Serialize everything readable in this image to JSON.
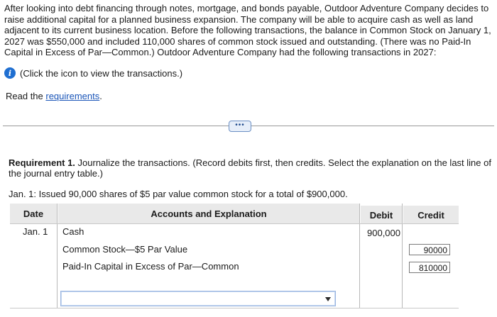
{
  "intro": {
    "paragraph": "After looking into debt financing through notes, mortgage, and bonds payable, Outdoor Adventure Company decides to raise additional capital for a planned business expansion. The company will be able to acquire cash as well as land adjacent to its current business location. Before the following transactions, the balance in Common Stock on January 1, 2027 was $550,000 and included 110,000 shares of common stock issued and outstanding. (There was no Paid-In Capital in Excess of Par—Common.) Outdoor Adventure Company had the following transactions in 2027:",
    "info_icon_glyph": "i",
    "info_link_text": "(Click the icon to view the transactions.)"
  },
  "read": {
    "prefix": "Read the ",
    "link_text": "requirements",
    "suffix": "."
  },
  "more_button": "•••",
  "requirement": {
    "title": "Requirement 1.",
    "instructions": " Journalize the transactions. (Record debits first, then credits. Select the explanation on the last line of the journal entry table.)",
    "transaction": "Jan. 1: Issued 90,000 shares of $5 par value common stock for a total of $900,000."
  },
  "journal": {
    "headers": {
      "date": "Date",
      "accounts": "Accounts and Explanation",
      "debit": "Debit",
      "credit": "Credit"
    },
    "rows": [
      {
        "date": "Jan. 1",
        "account": "Cash",
        "debit": "900,000",
        "credit": ""
      },
      {
        "date": "",
        "account": "Common Stock—$5 Par Value",
        "debit": "",
        "credit": "90000"
      },
      {
        "date": "",
        "account": "Paid-In Capital in Excess of Par—Common",
        "debit": "",
        "credit": "810000"
      }
    ],
    "explanation_selected": ""
  },
  "colors": {
    "link": "#1a55b8",
    "info_icon": "#1f6fd1",
    "header_bg": "#e9e9e9"
  }
}
